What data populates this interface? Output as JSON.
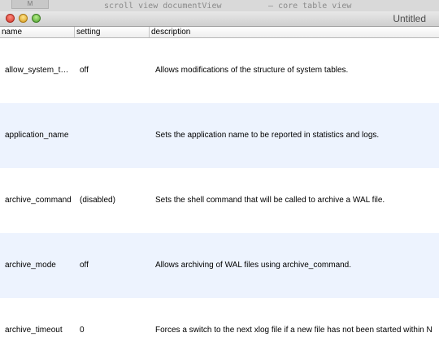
{
  "background_window": {
    "tab_label": "M",
    "code_left": "scroll view documentView",
    "code_right": "core table view"
  },
  "window": {
    "title": "Untitled"
  },
  "table": {
    "columns": [
      "name",
      "setting",
      "description"
    ],
    "rows": [
      {
        "name": "allow_system_t…",
        "setting": "off",
        "description": "Allows modifications of the structure of system tables."
      },
      {
        "name": "application_name",
        "setting": "",
        "description": "Sets the application name to be reported in statistics and logs."
      },
      {
        "name": "archive_command",
        "setting": "(disabled)",
        "description": "Sets the shell command that will be called to archive a WAL file."
      },
      {
        "name": "archive_mode",
        "setting": "off",
        "description": "Allows archiving of WAL files using archive_command."
      },
      {
        "name": "archive_timeout",
        "setting": "0",
        "description": "Forces a switch to the next xlog file if a new file has not been started within N"
      }
    ]
  },
  "colors": {
    "alt_row": "#edf3fe",
    "row": "#ffffff"
  }
}
